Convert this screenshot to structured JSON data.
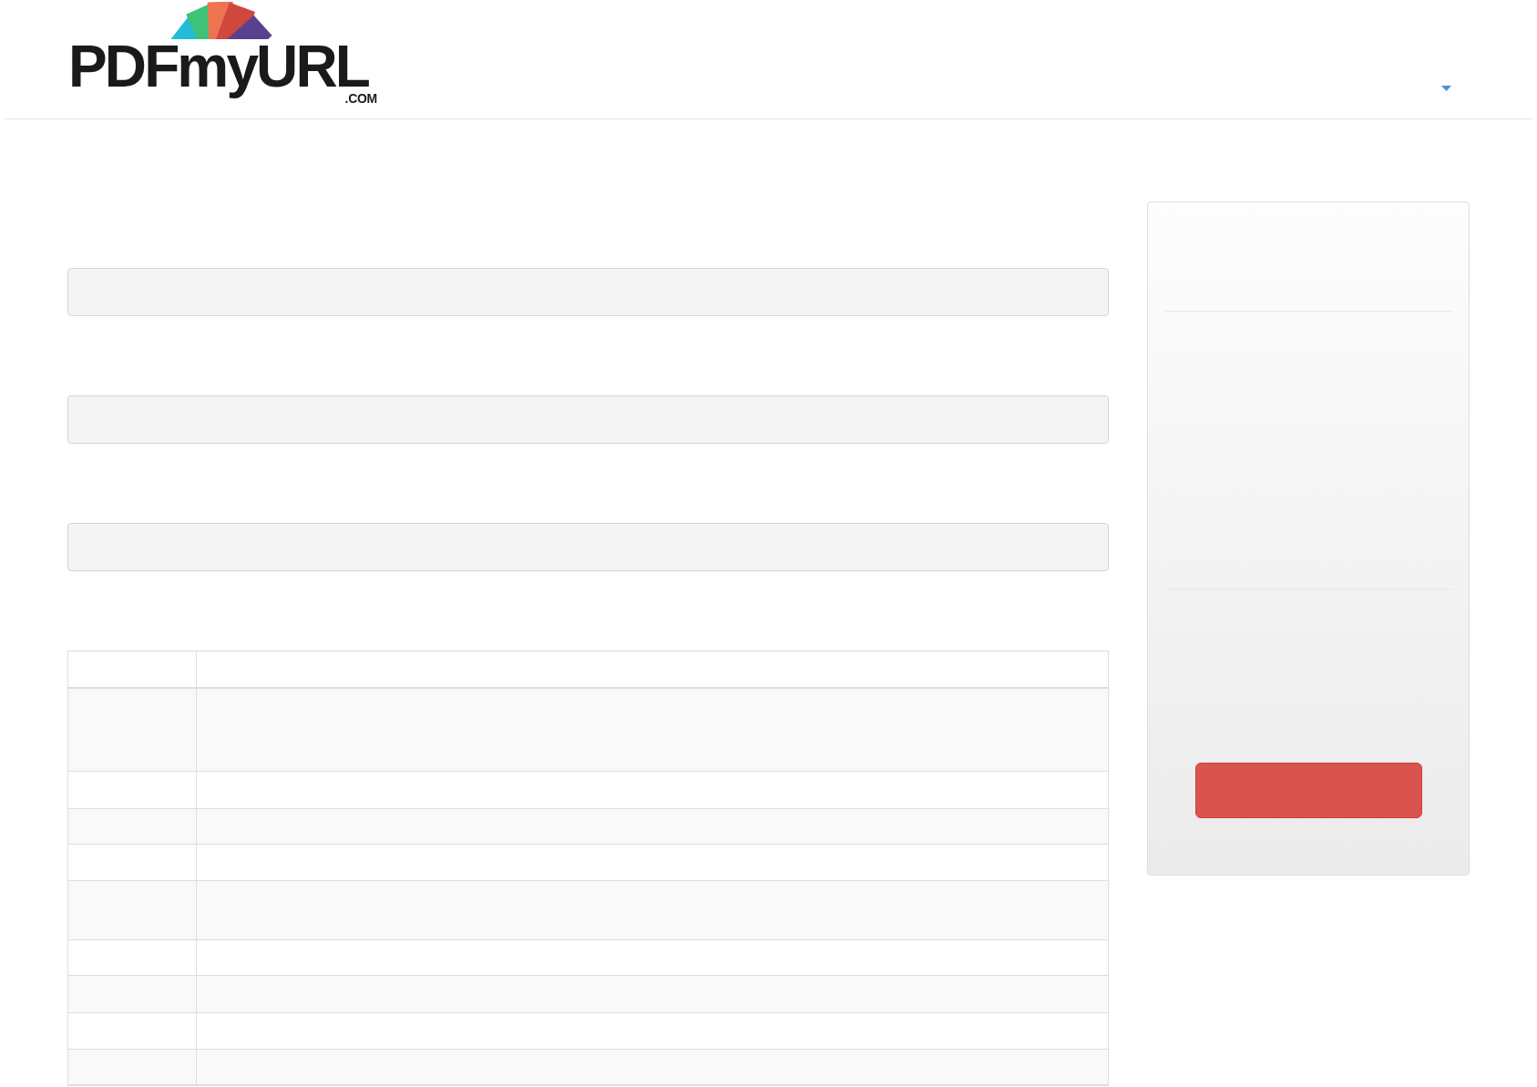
{
  "logo": {
    "wordmark": "PDFmyURL",
    "domain": ".COM"
  }
}
